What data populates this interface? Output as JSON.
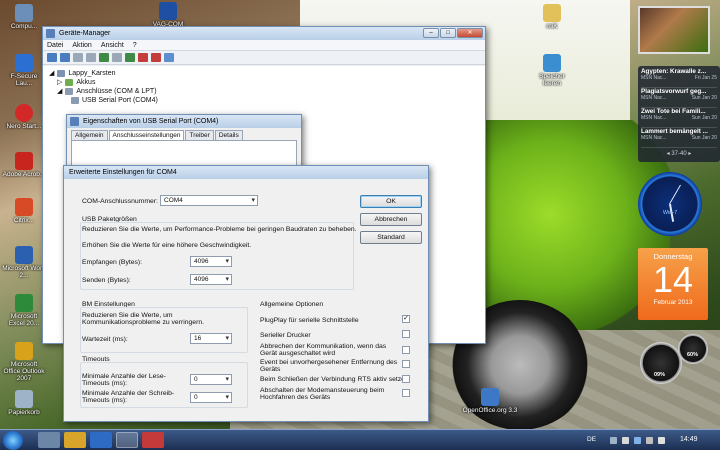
{
  "desktop": {
    "icons": [
      {
        "label": "Compu...",
        "name": "computer-icon"
      },
      {
        "label": "F-Secure Lau...",
        "name": "fsecure-icon"
      },
      {
        "label": "Nero Start...",
        "name": "nero-icon"
      },
      {
        "label": "Adobe Acrob...",
        "name": "adobe-icon"
      },
      {
        "label": "Citrix...",
        "name": "citrix-icon"
      },
      {
        "label": "Microsoft Word 2...",
        "name": "word-icon"
      },
      {
        "label": "Microsoft Excel 20...",
        "name": "excel-icon"
      },
      {
        "label": "Microsoft Office Outlook 2007",
        "name": "outlook-icon"
      },
      {
        "label": "Papierkorb",
        "name": "recycle-bin-icon"
      },
      {
        "label": "miK",
        "name": "folder-icon"
      },
      {
        "label": "Speicher leeren",
        "name": "memory-clean-icon"
      },
      {
        "label": "OpenOffice.org 3.3",
        "name": "openoffice-icon"
      },
      {
        "label": "VAG-COM",
        "name": "vagcom-icon"
      }
    ]
  },
  "device_manager": {
    "title": "Geräte-Manager",
    "menu": [
      "Datei",
      "Aktion",
      "Ansicht",
      "?"
    ],
    "tree": [
      {
        "label": "Lappy_Karsten",
        "level": 0
      },
      {
        "label": "Akkus",
        "level": 1
      },
      {
        "label": "Anschlüsse (COM & LPT)",
        "level": 1
      },
      {
        "label": "USB Serial Port (COM4)",
        "level": 2
      }
    ]
  },
  "properties": {
    "title": "Eigenschaften von USB Serial Port (COM4)",
    "tabs": [
      "Allgemein",
      "Anschlusseinstellungen",
      "Treiber",
      "Details"
    ],
    "active_tab": "Anschlusseinstellungen"
  },
  "advanced": {
    "title": "Erweiterte Einstellungen für COM4",
    "com_label": "COM-Anschlussnummer:",
    "com_value": "COM4",
    "usb_group": "USB Paketgrößen",
    "usb_text1": "Reduzieren Sie die Werte, um Performance-Probleme bei geringen Baudraten zu beheben.",
    "usb_text2": "Erhöhen Sie die Werte für eine höhere Geschwindigkeit.",
    "receive_label": "Empfangen (Bytes):",
    "receive_value": "4096",
    "send_label": "Senden (Bytes):",
    "send_value": "4096",
    "bm_group": "BM Einstellungen",
    "bm_text": "Reduzieren Sie die Werte, um Kommunikationsprobleme zu verringern.",
    "latency_label": "Wartezeit (ms):",
    "latency_value": "16",
    "timeouts_group": "Timeouts",
    "read_timeout_label": "Minimale Anzahle der Lese-Timeouts (ms):",
    "read_timeout_value": "0",
    "write_timeout_label": "Minimale Anzahle der Schreib-Timeouts (ms):",
    "write_timeout_value": "0",
    "general_group": "Allgemeine Optionen",
    "options": [
      {
        "label": "PlugPlay für serielle Schnittstelle",
        "checked": true
      },
      {
        "label": "Serieller Drucker",
        "checked": false
      },
      {
        "label": "Abbrechen der Kommunikation, wenn das Gerät ausgeschaltet wird",
        "checked": false
      },
      {
        "label": "Event bei unvorhergesehener Entfernung des Geräts",
        "checked": false
      },
      {
        "label": "Beim Schließen der Verbindung RTS aktiv setzen",
        "checked": false
      },
      {
        "label": "Abschalten der Modemansteuerung beim Hochfahren des Geräts",
        "checked": false
      }
    ],
    "ok": "OK",
    "cancel": "Abbrechen",
    "standard": "Standard"
  },
  "news": {
    "items": [
      {
        "title": "Ägypten: Krawalle z...",
        "source": "MSN Nac...",
        "date": "Fri Jan 25"
      },
      {
        "title": "Plagiatsvorwurf geg...",
        "source": "MSN Nac...",
        "date": "Sun Jan 20"
      },
      {
        "title": "Zwei Tote bei Famili...",
        "source": "MSN Nac...",
        "date": "Sun Jan 20"
      },
      {
        "title": "Lammert bemängelt ...",
        "source": "MSN Nac...",
        "date": "Sun Jan 20"
      }
    ],
    "pager": "37-40"
  },
  "clock": {
    "label": "Win-7"
  },
  "calendar": {
    "weekday": "Donnerstag",
    "day": "14",
    "month": "Februar 2013"
  },
  "meter": {
    "cpu": "09%",
    "ram": "60%"
  },
  "taskbar": {
    "language": "DE",
    "time": "14:49"
  },
  "colors": {
    "accent": "#3c7fb1",
    "calendar": "#ef6a1c",
    "taskbar": "#1c2f52"
  }
}
